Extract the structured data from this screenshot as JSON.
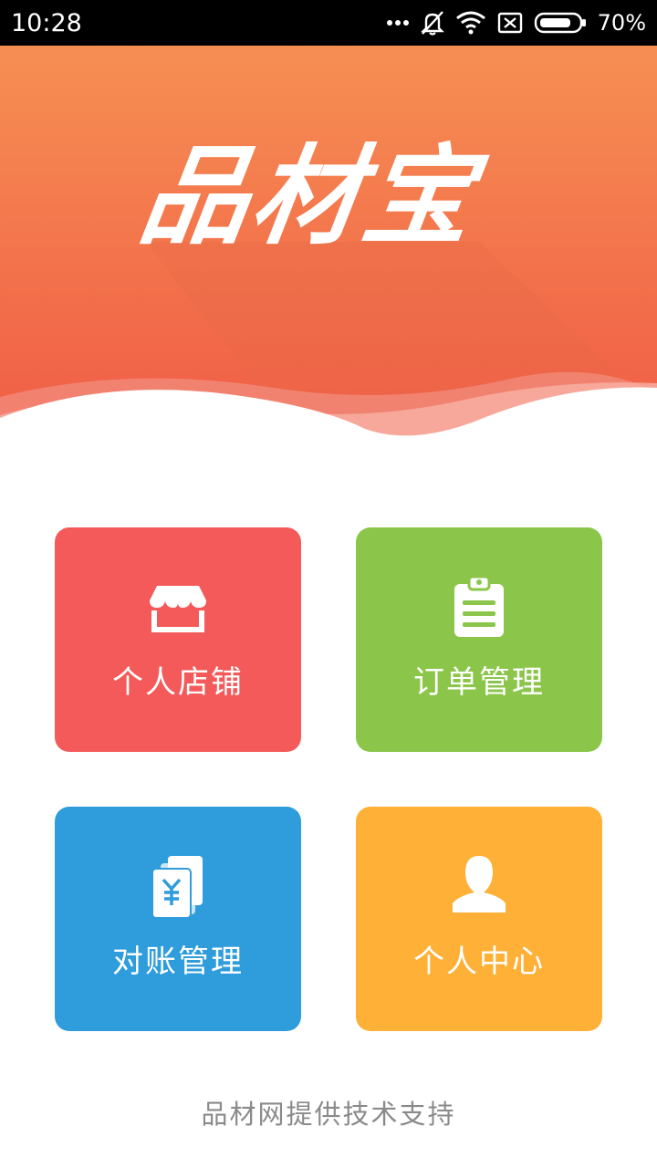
{
  "status_bar": {
    "time": "10:28",
    "battery": "70%",
    "icons": [
      "more-dots-icon",
      "bell-off-icon",
      "wifi-icon",
      "no-sim-icon",
      "battery-icon"
    ]
  },
  "header": {
    "logo_text": "品材宝",
    "colors": {
      "top": "#f68f53",
      "bottom": "#f05a45"
    }
  },
  "menu": {
    "store": {
      "label": "个人店铺",
      "icon": "storefront-icon",
      "color": "#f45a5a"
    },
    "orders": {
      "label": "订单管理",
      "icon": "clipboard-icon",
      "color": "#8bc64a"
    },
    "billing": {
      "label": "对账管理",
      "icon": "yen-document-icon",
      "color": "#2f9cdc"
    },
    "profile": {
      "label": "个人中心",
      "icon": "user-icon",
      "color": "#feb037"
    }
  },
  "footer": {
    "text": "品材网提供技术支持"
  }
}
